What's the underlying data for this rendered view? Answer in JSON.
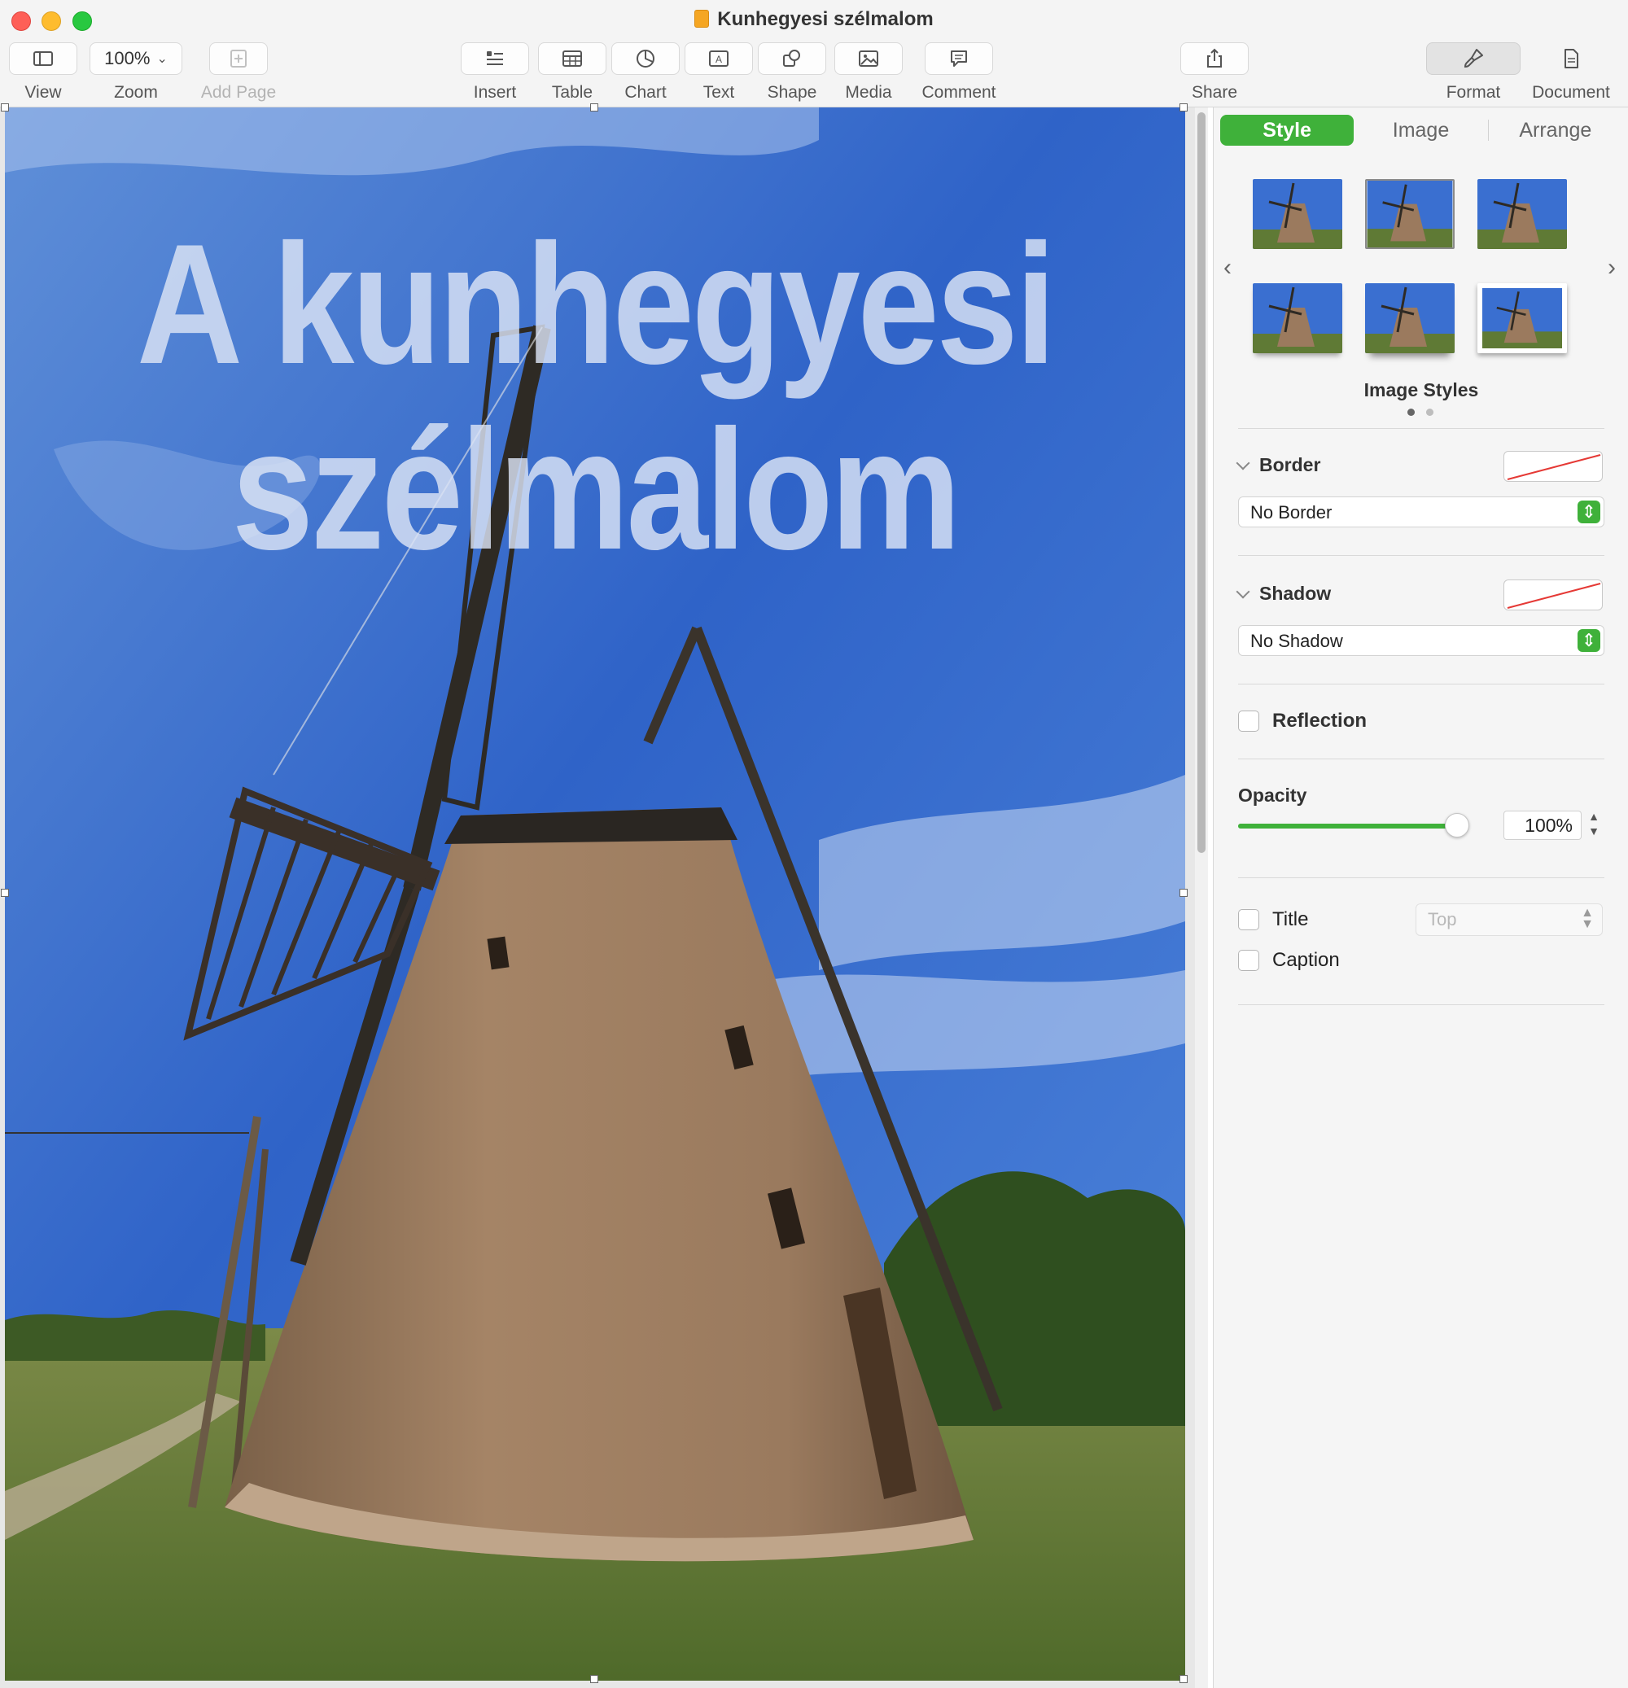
{
  "window": {
    "title": "Kunhegyesi szélmalom"
  },
  "toolbar": {
    "view": "View",
    "zoom": "Zoom",
    "zoom_value": "100%",
    "add_page": "Add Page",
    "insert": "Insert",
    "table": "Table",
    "chart": "Chart",
    "text": "Text",
    "shape": "Shape",
    "media": "Media",
    "comment": "Comment",
    "share": "Share",
    "format": "Format",
    "document": "Document"
  },
  "document": {
    "title_line1": "A kunhegyesi",
    "title_line2": "szélmalom"
  },
  "inspector": {
    "tabs": {
      "style": "Style",
      "image": "Image",
      "arrange": "Arrange"
    },
    "image_styles_label": "Image Styles",
    "border": {
      "label": "Border",
      "value": "No Border"
    },
    "shadow": {
      "label": "Shadow",
      "value": "No Shadow"
    },
    "reflection": {
      "label": "Reflection",
      "checked": false
    },
    "opacity": {
      "label": "Opacity",
      "value": "100%",
      "level": 1.0
    },
    "title": {
      "label": "Title",
      "position": "Top",
      "checked": false
    },
    "caption": {
      "label": "Caption",
      "checked": false
    }
  },
  "colors": {
    "accent": "#3fb13a",
    "sky": "#3a6fd0",
    "brick": "#9b7a5e"
  }
}
